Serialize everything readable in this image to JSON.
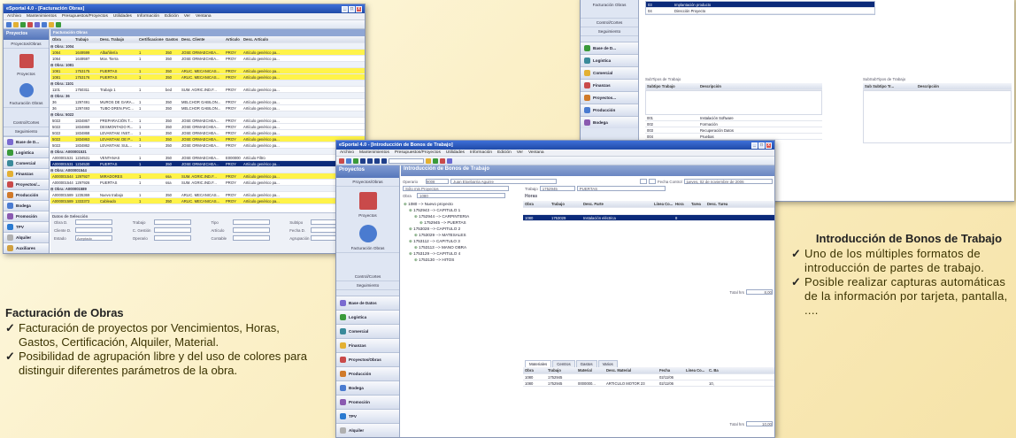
{
  "left_window": {
    "title": "eSportal 4.0 - [Facturación Obras]",
    "menu": [
      "Archivo",
      "Mantenimientos",
      "Presupuestos/Proyectos",
      "Utilidades",
      "Información",
      "Edición",
      "Ver",
      "Ventana"
    ],
    "nav_header": "Proyectos",
    "nav_items": [
      "Proyectos/Obras",
      "Proyectos",
      "Facturación Obras",
      "Control/Cortes",
      "Seguimiento"
    ],
    "nav_buttons": [
      "Base de D...",
      "Logística",
      "Comercial",
      "Finanzas",
      "Proyectos/...",
      "Producción",
      "Bodega",
      "Promoción",
      "TPV",
      "Alquiler",
      "Auxiliares"
    ],
    "panel_title": "Facturación Obras",
    "columns": [
      "Obra",
      "Trabajo",
      "Desc. Trabajo",
      "Certificaciones",
      "Gastos",
      "Desc. Cliente",
      "Artículo",
      "Desc. Artículo"
    ],
    "rows": [
      {
        "type": "group",
        "text": "Obra: 1004"
      },
      {
        "type": "yellow",
        "cells": [
          "1064",
          "1649599",
          "Albañilería",
          "1",
          "350",
          "JOSE ORMAECHEA...",
          "PROY",
          "Artículo genérico pa..."
        ]
      },
      {
        "type": "normal",
        "cells": [
          "1064",
          "1649597",
          "Mov. Tierra",
          "1",
          "350",
          "JOSE ORMAECHEA...",
          "PROY",
          "Artículo genérico pa..."
        ]
      },
      {
        "type": "group",
        "text": "Obra: 1081"
      },
      {
        "type": "yellow",
        "cells": [
          "1081",
          "1753175",
          "PUERTAS",
          "1",
          "350",
          "ARLIC. MECANICAS...",
          "PROY",
          "Artículo genérico pa..."
        ]
      },
      {
        "type": "yellow",
        "cells": [
          "1081",
          "1753176",
          "PUERTAS",
          "1",
          "350",
          "ARLIC. MECANICAS...",
          "PROY",
          "Artículo genérico pa..."
        ]
      },
      {
        "type": "group",
        "text": "Obra: 1101"
      },
      {
        "type": "normal",
        "cells": [
          "1101",
          "1750311",
          "Trabajo 1",
          "1",
          "bed",
          "SUM. AGRIC.IND.F...",
          "PROY",
          "Artículo genérico pa..."
        ]
      },
      {
        "type": "group",
        "text": "Obra: 36"
      },
      {
        "type": "normal",
        "cells": [
          "36",
          "1297491",
          "MUROS DE GARA...",
          "1",
          "350",
          "MELCHOR GABILON...",
          "PROY",
          "Artículo genérico pa..."
        ]
      },
      {
        "type": "normal",
        "cells": [
          "36",
          "1297493",
          "TUBO DREN.PVC...",
          "1",
          "350",
          "MELCHOR GABILON...",
          "PROY",
          "Artículo genérico pa..."
        ]
      },
      {
        "type": "group",
        "text": "Obra: 5022"
      },
      {
        "type": "normal",
        "cells": [
          "5022",
          "1834867",
          "PREPARACIÓN T...",
          "1",
          "350",
          "JOSE ORMAECHEA...",
          "PROY",
          "Artículo genérico pa..."
        ]
      },
      {
        "type": "normal",
        "cells": [
          "5022",
          "1834869",
          "DESMONTADO R...",
          "1",
          "350",
          "JOSE ORMAECHEA...",
          "PROY",
          "Artículo genérico pa..."
        ]
      },
      {
        "type": "normal",
        "cells": [
          "5022",
          "1834868",
          "LEVANTAM. INST...",
          "1",
          "350",
          "JOSE ORMAECHEA...",
          "PROY",
          "Artículo genérico pa..."
        ]
      },
      {
        "type": "yellow",
        "cells": [
          "5022",
          "1834863",
          "LEVANTAM. DE P...",
          "1",
          "350",
          "JOSE ORMAECHEA...",
          "PROY",
          "Artículo genérico pa..."
        ]
      },
      {
        "type": "normal",
        "cells": [
          "5022",
          "1834862",
          "LEVANTAM. SUL...",
          "1",
          "350",
          "JOSE ORMAECHEA...",
          "PROY",
          "Artículo genérico pa..."
        ]
      },
      {
        "type": "group",
        "text": "Obra: A000001531"
      },
      {
        "type": "normal",
        "cells": [
          "A000001531",
          "1234531",
          "VENTANAS",
          "1",
          "350",
          "JOSE ORMAECHEA...",
          "E000000",
          "Artículo Filtro"
        ]
      },
      {
        "type": "sel",
        "cells": [
          "A000001531",
          "1234530",
          "PUERTAS",
          "1",
          "350",
          "JOSE ORMAECHEA...",
          "PROY",
          "Artículo genérico pa..."
        ]
      },
      {
        "type": "group",
        "text": "Obra: A000001544"
      },
      {
        "type": "yellow",
        "cells": [
          "A000001544",
          "1297927",
          "MIRADORES",
          "1",
          "ssa",
          "SUM. AGRIC.IND.F...",
          "PROY",
          "Artículo genérico pa..."
        ]
      },
      {
        "type": "normal",
        "cells": [
          "A000001544",
          "1297926",
          "PUERTAS",
          "1",
          "ssa",
          "SUM. AGRIC.IND.F...",
          "PROY",
          "Artículo genérico pa..."
        ]
      },
      {
        "type": "group",
        "text": "Obra: A000001589"
      },
      {
        "type": "normal",
        "cells": [
          "A000001589",
          "1235369",
          "Nuevo trabajo",
          "1",
          "350",
          "ARLIC. MECANICAS...",
          "PROY",
          "Artículo genérico pa..."
        ]
      },
      {
        "type": "yellow",
        "cells": [
          "A000001589",
          "1333372",
          "Cableado",
          "1",
          "350",
          "ARLIC. MECANICAS...",
          "PROY",
          "Artículo genérico pa..."
        ]
      }
    ],
    "filter_title": "Datos de Selección",
    "filter_labels": [
      "Obra D.",
      "Trabajo",
      "Tipo",
      "Subtipo",
      "Cliente D.",
      "C. Gestión",
      "Artículo",
      "Fecha D.",
      "Estado",
      "Operario",
      "Contable",
      "Agrupación"
    ],
    "estado_value": "Aceptado",
    "combinar_label": "Combinar Ti..."
  },
  "right_window": {
    "nav_items": [
      "Facturación Obras",
      "Control/Cortes",
      "Seguimiento"
    ],
    "nav_buttons": [
      "Base de D...",
      "Logística",
      "Comercial",
      "Finanzas",
      "Proyectos...",
      "Producción",
      "Bodega"
    ],
    "top_rows": [
      [
        "03",
        "Implantación producto"
      ],
      [
        "04",
        "Dirección Proyecto"
      ]
    ],
    "subtipos_title": "SubTipos de Trabajo",
    "subtipos_cols": [
      "Subtipo Trabajo",
      "Descripción"
    ],
    "subtipos_rows": [
      [
        "001",
        "Instalación Software"
      ],
      [
        "002",
        "Formación"
      ],
      [
        "003",
        "Recuperación Datos"
      ],
      [
        "004",
        "Pruebas"
      ]
    ],
    "subsubtipos_title": "SubSubTipos de Trabajo",
    "subsubtipos_cols": [
      "Sub Subtipo Tr...",
      "Descripción"
    ]
  },
  "center_window": {
    "title": "eSportal 4.0 - [Introducción de Bonos de Trabajo]",
    "menu": [
      "Archivo",
      "Mantenimientos",
      "Presupuestos/Proyectos",
      "Utilidades",
      "Información",
      "Edición",
      "Ver",
      "Ventana"
    ],
    "nav_header": "Proyectos",
    "nav_items": [
      "Proyectos/Obras",
      "Proyectos",
      "Facturación Obras",
      "Control/Cortes",
      "Seguimiento"
    ],
    "nav_buttons": [
      "Base de Datos",
      "Logística",
      "Comercial",
      "Finanzas",
      "Proyectos/Obras",
      "Producción",
      "Bodega",
      "Promoción",
      "TPV",
      "Alquiler",
      "Auxiliares"
    ],
    "panel_title": "Introducción de Bonos de Trabajo",
    "operario_label": "Operario",
    "operario_code": "9008",
    "operario_name": "Juan Etxebarria Aguirre",
    "fecha_label": "Fecha Control",
    "fecha_value": "jueves, 02 de noviembre de 2006",
    "solo_label": "Sólo mis Proyectos",
    "obra_label": "Obra",
    "obra_value": "1080",
    "trabajo_label": "Trabajo",
    "trabajo_value": "1752945",
    "trabajo_desc": "PUERTAS",
    "tree": [
      "1080 --> Nuevo proyecto",
      "1752943 --> CAPITULO 1",
      "1752944 --> CARPINTERIA",
      "1752945 --> PUERTAS",
      "1753028 --> CAPITULO 2",
      "1753029 --> MATESALES",
      "1753112 --> CAPITULO 3",
      "1753113 --> MANO OBRA",
      "1753129 --> CAPITULO 4",
      "1753130 --> HITOS"
    ],
    "horas_title": "Horas",
    "horas_cols": [
      "Obra",
      "Trabajo",
      "Desc. Parte",
      "Línea Co...",
      "Hora",
      "Tarea",
      "Desc. Tarea"
    ],
    "horas_row": [
      "1080",
      "1753029",
      "Instalación eléctrica",
      "",
      "8",
      "",
      ""
    ],
    "total_label": "Total hrs",
    "total_value": "8,00",
    "tabs": [
      "Materiales",
      "Centros",
      "Gastos",
      "Varios"
    ],
    "mat_cols": [
      "Obra",
      "Trabajo",
      "Material",
      "Desc. Material",
      "Fecha",
      "Línea Co...",
      "C. Ba"
    ],
    "mat_rows": [
      [
        "1080",
        "1752945",
        "",
        "",
        "02/11/06",
        "",
        ""
      ],
      [
        "1080",
        "1752945",
        "0000000...",
        "ARTICULO MOTOR 23",
        "02/11/06",
        "",
        "10,"
      ]
    ],
    "total2_value": "10,00"
  },
  "captions": {
    "facturacion": {
      "title": "Facturación de Obras",
      "items": [
        "Facturación de proyectos por Vencimientos, Horas, Gastos, Certificación, Alquiler, Material.",
        "Posibilidad de agrupación libre y del uso de colores para distinguir diferentes parámetros de la obra."
      ]
    },
    "bonos": {
      "title": "Introducción de Bonos de Trabajo",
      "items": [
        "Uno de los múltiples formatos de introducción de partes de trabajo.",
        "Posible realizar capturas automáticas de la información por tarjeta, pantalla, ...."
      ]
    }
  }
}
